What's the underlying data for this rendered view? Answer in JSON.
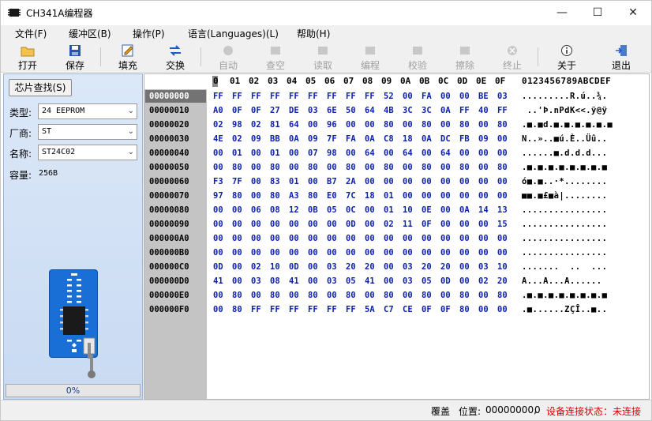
{
  "window": {
    "title": "CH341A编程器",
    "minimize": "—",
    "maximize": "☐",
    "close": "✕"
  },
  "menu": [
    "文件(F)",
    "缓冲区(B)",
    "操作(P)",
    "语言(Languages)(L)",
    "帮助(H)"
  ],
  "toolbar": [
    {
      "label": "打开",
      "icon": "open-folder-icon",
      "enabled": true
    },
    {
      "label": "保存",
      "icon": "save-disk-icon",
      "enabled": true
    },
    {
      "label": "填充",
      "icon": "fill-icon",
      "enabled": true
    },
    {
      "label": "交换",
      "icon": "swap-arrows-icon",
      "enabled": true
    },
    {
      "label": "自动",
      "icon": "auto-icon",
      "enabled": false
    },
    {
      "label": "查空",
      "icon": "blank-check-icon",
      "enabled": false
    },
    {
      "label": "读取",
      "icon": "read-icon",
      "enabled": false
    },
    {
      "label": "编程",
      "icon": "program-icon",
      "enabled": false
    },
    {
      "label": "校验",
      "icon": "verify-icon",
      "enabled": false
    },
    {
      "label": "擦除",
      "icon": "erase-icon",
      "enabled": false
    },
    {
      "label": "终止",
      "icon": "stop-icon",
      "enabled": false
    },
    {
      "label": "关于",
      "icon": "info-icon",
      "enabled": true
    },
    {
      "label": "退出",
      "icon": "exit-door-icon",
      "enabled": true
    }
  ],
  "left_panel": {
    "chip_search": "芯片查找(S)",
    "type_label": "类型:",
    "type_value": "24 EEPROM",
    "vendor_label": "厂商:",
    "vendor_value": "ST",
    "name_label": "名称:",
    "name_value": "ST24C02",
    "capacity_label": "容量:",
    "capacity_value": "256B",
    "progress_text": "0%",
    "progress": 0
  },
  "hex": {
    "columns": [
      "0",
      "01",
      "02",
      "03",
      "04",
      "05",
      "06",
      "07",
      "08",
      "09",
      "0A",
      "0B",
      "0C",
      "0D",
      "0E",
      "0F"
    ],
    "ascii_header": "0123456789ABCDEF",
    "rows": [
      {
        "addr": "00000000",
        "bytes": [
          "FF",
          "FF",
          "FF",
          "FF",
          "FF",
          "FF",
          "FF",
          "FF",
          "FF",
          "52",
          "00",
          "FA",
          "00",
          "00",
          "BE",
          "03"
        ],
        "ascii": ".........R.ú..¾."
      },
      {
        "addr": "00000010",
        "bytes": [
          "A0",
          "0F",
          "0F",
          "27",
          "DE",
          "03",
          "6E",
          "50",
          "64",
          "4B",
          "3C",
          "3C",
          "0A",
          "FF",
          "40",
          "FF"
        ],
        "ascii": " ..'Þ.nPdK<<.ÿ@ÿ"
      },
      {
        "addr": "00000020",
        "bytes": [
          "02",
          "98",
          "02",
          "81",
          "64",
          "00",
          "96",
          "00",
          "00",
          "80",
          "00",
          "80",
          "00",
          "80",
          "00",
          "80"
        ],
        "ascii": ".■.■d.■.■.■.■.■.■"
      },
      {
        "addr": "00000030",
        "bytes": [
          "4E",
          "02",
          "09",
          "BB",
          "0A",
          "09",
          "7F",
          "FA",
          "0A",
          "C8",
          "18",
          "0A",
          "DC",
          "FB",
          "09",
          "00"
        ],
        "ascii": "N..»..■ú.È..Üû.."
      },
      {
        "addr": "00000040",
        "bytes": [
          "00",
          "01",
          "00",
          "01",
          "00",
          "07",
          "98",
          "00",
          "64",
          "00",
          "64",
          "00",
          "64",
          "00",
          "00",
          "00"
        ],
        "ascii": "......■.d.d.d..."
      },
      {
        "addr": "00000050",
        "bytes": [
          "00",
          "80",
          "00",
          "80",
          "00",
          "80",
          "00",
          "80",
          "00",
          "80",
          "00",
          "80",
          "00",
          "80",
          "00",
          "80"
        ],
        "ascii": ".■.■.■.■.■.■.■.■"
      },
      {
        "addr": "00000060",
        "bytes": [
          "F3",
          "7F",
          "00",
          "83",
          "01",
          "00",
          "B7",
          "2A",
          "00",
          "00",
          "00",
          "00",
          "00",
          "00",
          "00",
          "00"
        ],
        "ascii": "ó■.■..·*........"
      },
      {
        "addr": "00000070",
        "bytes": [
          "97",
          "80",
          "00",
          "80",
          "A3",
          "80",
          "E0",
          "7C",
          "18",
          "01",
          "00",
          "00",
          "00",
          "00",
          "00",
          "00"
        ],
        "ascii": "■■.■£■à|........"
      },
      {
        "addr": "00000080",
        "bytes": [
          "00",
          "00",
          "06",
          "08",
          "12",
          "0B",
          "05",
          "0C",
          "00",
          "01",
          "10",
          "0E",
          "00",
          "0A",
          "14",
          "13"
        ],
        "ascii": "................"
      },
      {
        "addr": "00000090",
        "bytes": [
          "00",
          "00",
          "00",
          "00",
          "00",
          "00",
          "00",
          "0D",
          "00",
          "02",
          "11",
          "0F",
          "00",
          "00",
          "00",
          "15"
        ],
        "ascii": "................"
      },
      {
        "addr": "000000A0",
        "bytes": [
          "00",
          "00",
          "00",
          "00",
          "00",
          "00",
          "00",
          "00",
          "00",
          "00",
          "00",
          "00",
          "00",
          "00",
          "00",
          "00"
        ],
        "ascii": "................"
      },
      {
        "addr": "000000B0",
        "bytes": [
          "00",
          "00",
          "00",
          "00",
          "00",
          "00",
          "00",
          "00",
          "00",
          "00",
          "00",
          "00",
          "00",
          "00",
          "00",
          "00"
        ],
        "ascii": "................"
      },
      {
        "addr": "000000C0",
        "bytes": [
          "0D",
          "00",
          "02",
          "10",
          "0D",
          "00",
          "03",
          "20",
          "20",
          "00",
          "03",
          "20",
          "20",
          "00",
          "03",
          "10"
        ],
        "ascii": ".......  ..  ..."
      },
      {
        "addr": "000000D0",
        "bytes": [
          "41",
          "00",
          "03",
          "08",
          "41",
          "00",
          "03",
          "05",
          "41",
          "00",
          "03",
          "05",
          "0D",
          "00",
          "02",
          "20"
        ],
        "ascii": "A...A...A...... "
      },
      {
        "addr": "000000E0",
        "bytes": [
          "00",
          "80",
          "00",
          "80",
          "00",
          "80",
          "00",
          "80",
          "00",
          "80",
          "00",
          "80",
          "00",
          "80",
          "00",
          "80"
        ],
        "ascii": ".■.■.■.■.■.■.■.■"
      },
      {
        "addr": "000000F0",
        "bytes": [
          "00",
          "80",
          "FF",
          "FF",
          "FF",
          "FF",
          "FF",
          "FF",
          "5A",
          "C7",
          "CE",
          "0F",
          "0F",
          "80",
          "00",
          "00"
        ],
        "ascii": ".■......ZÇÎ..■.."
      }
    ]
  },
  "status": {
    "mode": "覆盖",
    "position_label": "位置:",
    "position_value": "00000000,",
    "position_value2": "0",
    "connection": "设备连接状态：未连接"
  },
  "colors": {
    "hex_text": "#0e22a8",
    "address_bg": "#c4c4c4",
    "panel_bg": "#dce8f8",
    "socket_blue": "#1a6fd6",
    "disconnected": "#e00000"
  }
}
